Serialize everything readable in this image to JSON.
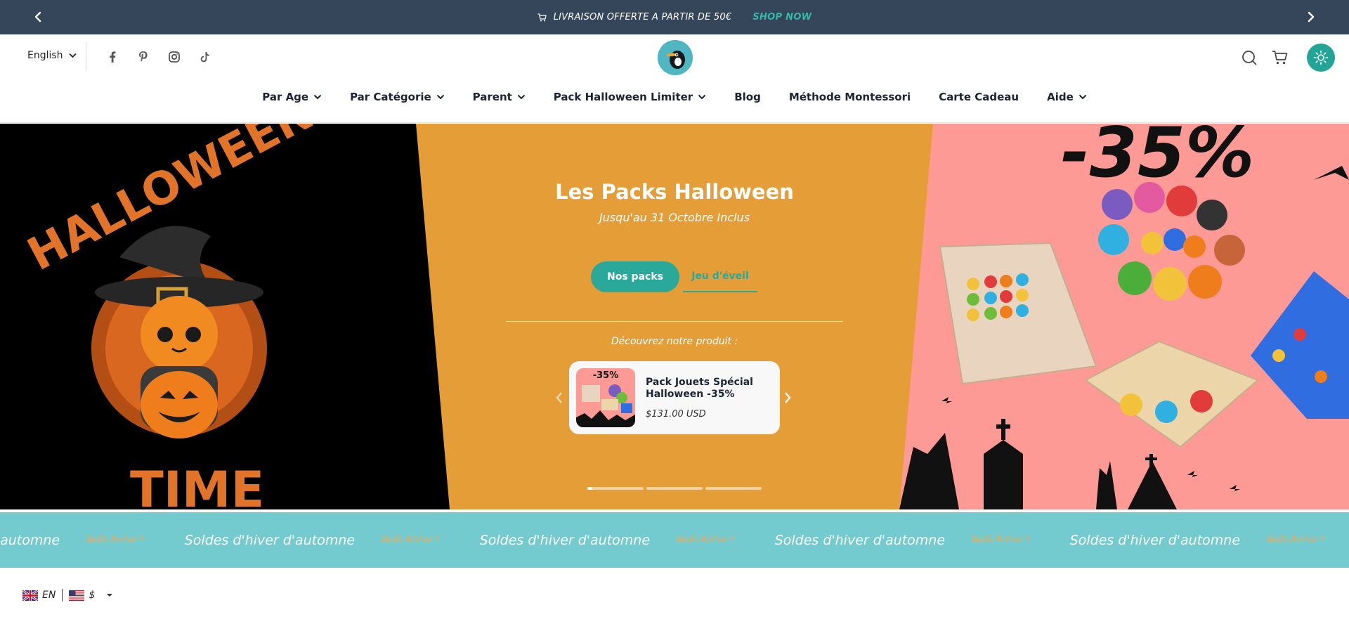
{
  "announcement": {
    "message": "LIVRAISON OFFERTE A PARTIR DE 50€",
    "cta": "SHOP NOW"
  },
  "header": {
    "language": "English",
    "social_icons": [
      "facebook-icon",
      "pinterest-icon",
      "instagram-icon",
      "tiktok-icon"
    ],
    "nav": [
      {
        "label": "Par Age",
        "dropdown": true
      },
      {
        "label": "Par Catégorie",
        "dropdown": true
      },
      {
        "label": "Parent",
        "dropdown": true
      },
      {
        "label": "Pack Halloween Limiter",
        "dropdown": true
      },
      {
        "label": "Blog",
        "dropdown": false
      },
      {
        "label": "Méthode Montessori",
        "dropdown": false
      },
      {
        "label": "Carte Cadeau",
        "dropdown": false
      },
      {
        "label": "Aide",
        "dropdown": true
      }
    ]
  },
  "hero": {
    "title": "Les Packs Halloween",
    "subtitle": "Jusqu'au 31 Octobre Inclus",
    "primary_button": "Nos packs",
    "secondary_button": "Jeu d'éveil",
    "discover_label": "Découvrez notre produit :",
    "product": {
      "name": "Pack Jouets Spécial Halloween -35%",
      "price": "$131.00 USD",
      "badge": "-35%"
    },
    "left_image_text": [
      "HALLOWEEN",
      "TIME"
    ],
    "right_image_text": "-35%",
    "slides": 3,
    "active_slide": 1
  },
  "ticker": {
    "items": [
      "ver d'automne",
      "Noël Arrive !",
      "Soldes d'hiver d'automne",
      "Noël Arrive !",
      "Soldes d'hiver d'automne",
      "Noël Arrive !",
      "Soldes d'hiver d'automne",
      "Noël Arrive !",
      "Soldes d'hiver d'automne",
      "Noël Arrive !"
    ]
  },
  "locale": {
    "language": "EN",
    "currency": "$"
  },
  "colors": {
    "announcement_bg": "#36465a",
    "accent": "#2aa99b",
    "hero_orange": "#e49d37",
    "hero_pink": "#fe9a96",
    "ticker_bg": "#73cbcf"
  }
}
